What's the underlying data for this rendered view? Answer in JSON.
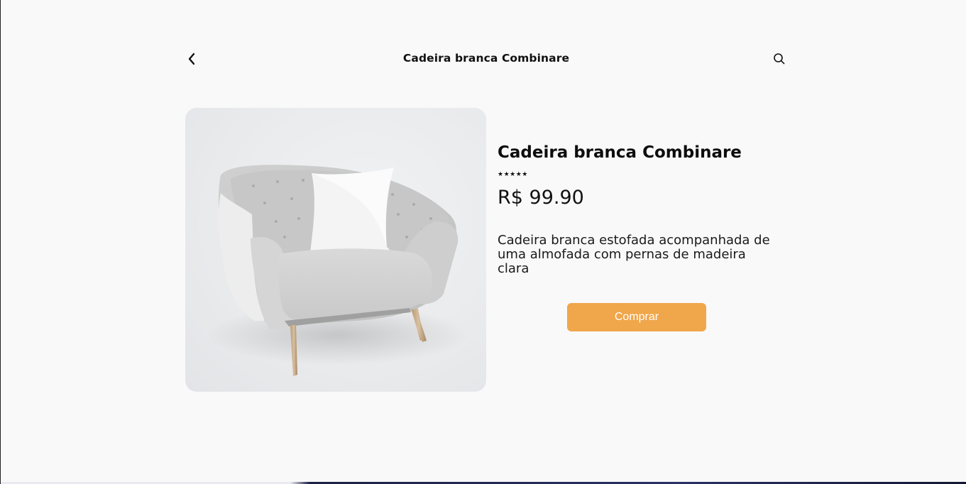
{
  "header": {
    "title": "Cadeira branca Combinare",
    "back_icon": "chevron-left-icon",
    "search_icon": "search-icon"
  },
  "product": {
    "name": "Cadeira branca Combinare",
    "rating": "★★★★★",
    "rating_value": 5,
    "price": "R$ 99.90",
    "description": "Cadeira branca estofada acompanhada de uma almofada com pernas de madeira clara",
    "image_alt": "Cadeira branca Combinare"
  },
  "actions": {
    "buy_label": "Comprar"
  },
  "colors": {
    "accent": "#f0a64a",
    "background": "#f9f9fa",
    "image_bg": "#eaebed"
  }
}
